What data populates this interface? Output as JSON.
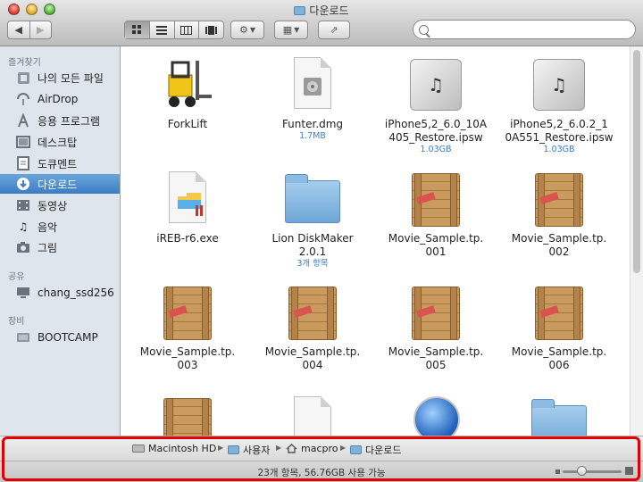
{
  "window": {
    "title": "다운로드"
  },
  "toolbar": {
    "view_modes": [
      "icon-view",
      "list-view",
      "column-view",
      "coverflow-view"
    ],
    "search_placeholder": ""
  },
  "sidebar": {
    "sections": [
      {
        "header": "즐겨찾기",
        "items": [
          {
            "label": "나의 모든 파일",
            "icon": "all-files-icon"
          },
          {
            "label": "AirDrop",
            "icon": "airdrop-icon"
          },
          {
            "label": "응용 프로그램",
            "icon": "applications-icon"
          },
          {
            "label": "데스크탑",
            "icon": "desktop-icon"
          },
          {
            "label": "도큐멘트",
            "icon": "documents-icon"
          },
          {
            "label": "다운로드",
            "icon": "downloads-icon",
            "selected": true
          },
          {
            "label": "동영상",
            "icon": "movies-icon"
          },
          {
            "label": "음악",
            "icon": "music-icon"
          },
          {
            "label": "그림",
            "icon": "pictures-icon"
          }
        ]
      },
      {
        "header": "공유",
        "items": [
          {
            "label": "chang_ssd256",
            "icon": "computer-icon"
          }
        ]
      },
      {
        "header": "장비",
        "items": [
          {
            "label": "BOOTCAMP",
            "icon": "drive-icon"
          }
        ]
      }
    ]
  },
  "files": [
    {
      "name1": "ForkLift",
      "name2": "",
      "sub": "",
      "icon": "forklift-app-icon"
    },
    {
      "name1": "Funter.dmg",
      "name2": "",
      "sub": "1.7MB",
      "icon": "dmg-icon"
    },
    {
      "name1": "iPhone5,2_6.0_10A",
      "name2": "405_Restore.ipsw",
      "sub": "1.03GB",
      "icon": "ipsw-icon"
    },
    {
      "name1": "iPhone5,2_6.0.2_1",
      "name2": "0A551_Restore.ipsw",
      "sub": "1.03GB",
      "icon": "ipsw-icon"
    },
    {
      "name1": "iREB-r6.exe",
      "name2": "",
      "sub": "",
      "icon": "exe-icon"
    },
    {
      "name1": "Lion DiskMaker",
      "name2": "2.0.1",
      "sub": "3개 항목",
      "icon": "folder-icon"
    },
    {
      "name1": "Movie_Sample.tp.",
      "name2": "001",
      "sub": "",
      "icon": "crate-icon"
    },
    {
      "name1": "Movie_Sample.tp.",
      "name2": "002",
      "sub": "",
      "icon": "crate-icon"
    },
    {
      "name1": "Movie_Sample.tp.",
      "name2": "003",
      "sub": "",
      "icon": "crate-icon"
    },
    {
      "name1": "Movie_Sample.tp.",
      "name2": "004",
      "sub": "",
      "icon": "crate-icon"
    },
    {
      "name1": "Movie_Sample.tp.",
      "name2": "005",
      "sub": "",
      "icon": "crate-icon"
    },
    {
      "name1": "Movie_Sample.tp.",
      "name2": "006",
      "sub": "",
      "icon": "crate-icon"
    },
    {
      "name1": "",
      "name2": "",
      "sub": "",
      "icon": "crate-icon"
    },
    {
      "name1": "",
      "name2": "",
      "sub": "",
      "icon": "document-icon"
    },
    {
      "name1": "",
      "name2": "",
      "sub": "",
      "icon": "quicktime-icon"
    },
    {
      "name1": "",
      "name2": "",
      "sub": "",
      "icon": "folder-icon"
    }
  ],
  "path_bar": [
    {
      "label": "Macintosh HD",
      "icon": "hard-drive-icon"
    },
    {
      "label": "사용자",
      "icon": "folder-icon"
    },
    {
      "label": "macpro",
      "icon": "home-icon"
    },
    {
      "label": "다운로드",
      "icon": "downloads-folder-icon"
    }
  ],
  "status_bar": {
    "text": "23개 항목, 56.76GB 사용 가능"
  },
  "colors": {
    "selection": "#3d7cc4",
    "highlight_border": "#e00000",
    "size_text": "#3a7bd5"
  }
}
